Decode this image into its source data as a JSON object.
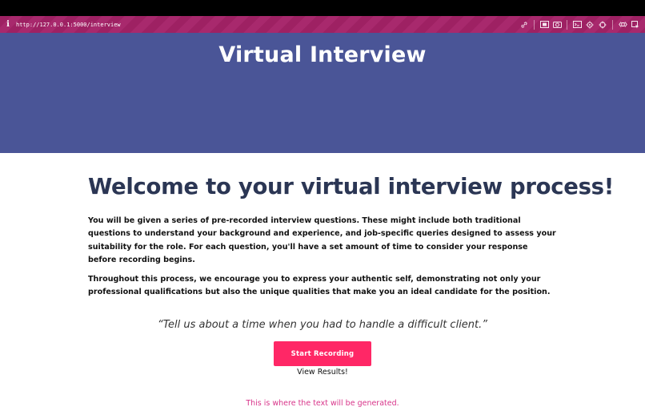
{
  "browser": {
    "url": "http://127.0.0.1:5000/interview",
    "info_glyph": "i"
  },
  "hero": {
    "title": "Virtual Interview"
  },
  "main": {
    "heading": "Welcome to your virtual interview process!",
    "paragraph1": "You will be given a series of pre-recorded interview questions. These might include both traditional questions to understand your background and experience, and job-specific queries designed to assess your suitability for the role. For each question, you'll have a set amount of time to consider your response before recording begins.",
    "paragraph2": "Throughout this process, we encourage you to express your authentic self, demonstrating not only your professional qualifications but also the unique qualities that make you an ideal candidate for the position.",
    "question": "“Tell us about a time when you had to handle a difficult client.”",
    "record_button_label": "Start Recording",
    "results_link": "View Results!",
    "generated_text": "This is where the text will be generated."
  },
  "colors": {
    "hero_bg": "#4a5597",
    "heading": "#2b3654",
    "record_button": "#ff2766",
    "generated_text": "#d8358a",
    "address_bar": "#9e2163"
  },
  "toolbar_icons": [
    "link-icon",
    "picture-in-picture-icon",
    "camera-icon",
    "terminal-icon",
    "settings-icon",
    "crosshair-icon",
    "responsive-icon",
    "inspect-icon"
  ]
}
